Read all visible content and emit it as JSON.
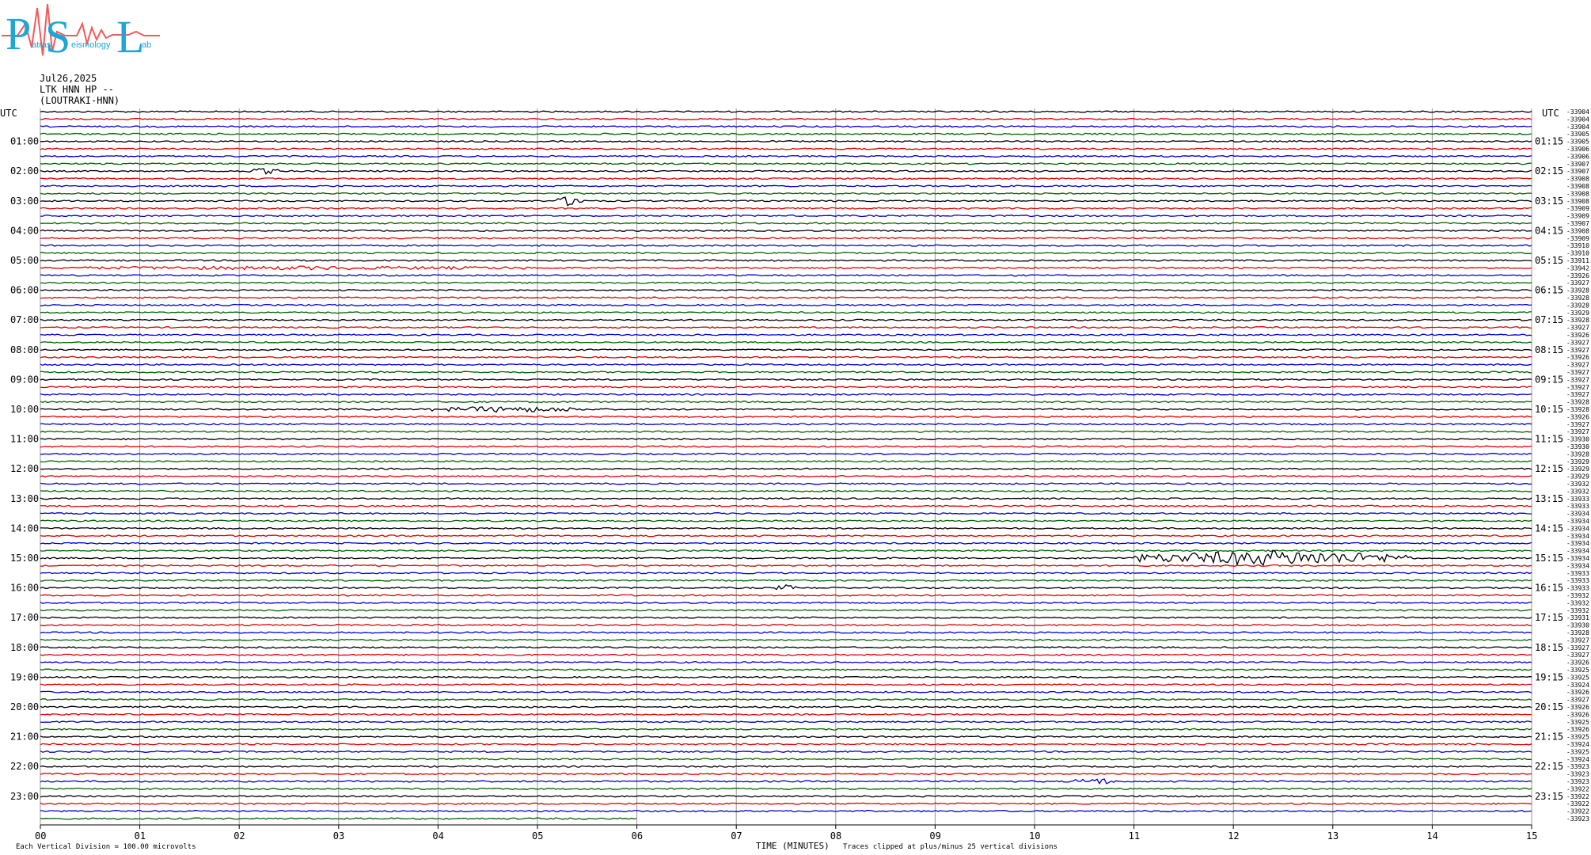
{
  "header": {
    "date": "Jul26,2025",
    "station": "LTK HNN HP --",
    "location": "(LOUTRAKI-HNN)"
  },
  "logo": {
    "letters": [
      "P",
      "S",
      "L"
    ],
    "words": [
      "atras",
      "eismology",
      "ab"
    ],
    "colors": {
      "letters": "#1fa6d6",
      "wave": "#f05a5a"
    }
  },
  "axis": {
    "left_title": "UTC",
    "right_title": "UTC",
    "xlabel": "TIME (MINUTES)",
    "x_ticks": [
      "00",
      "01",
      "02",
      "03",
      "04",
      "05",
      "06",
      "07",
      "08",
      "09",
      "10",
      "11",
      "12",
      "13",
      "14",
      "15"
    ]
  },
  "footer": {
    "division_note": "Each Vertical Division =  100.00 microvolts",
    "clip_note": "Traces clipped at plus/minus 25 vertical divisions"
  },
  "chart_data": {
    "type": "line",
    "description_kind": "helicorder",
    "rows": 96,
    "minutes_per_row": 15,
    "colors": [
      "#000000",
      "#e00000",
      "#0000d0",
      "#006400"
    ],
    "last_row_fraction": 0.4,
    "left_labels": [
      "01:00",
      "02:00",
      "03:00",
      "04:00",
      "05:00",
      "06:00",
      "07:00",
      "08:00",
      "09:00",
      "10:00",
      "11:00",
      "12:00",
      "13:00",
      "14:00",
      "15:00",
      "16:00",
      "17:00",
      "18:00",
      "19:00",
      "20:00",
      "21:00",
      "22:00",
      "23:00"
    ],
    "right_labels": [
      "01:15",
      "02:15",
      "03:15",
      "04:15",
      "05:15",
      "06:15",
      "07:15",
      "08:15",
      "09:15",
      "10:15",
      "11:15",
      "12:15",
      "13:15",
      "14:15",
      "15:15",
      "16:15",
      "17:15",
      "18:15",
      "19:15",
      "20:15",
      "21:15",
      "22:15",
      "23:15"
    ],
    "offsets": [
      "-33904",
      "-33904",
      "-33904",
      "-33905",
      "-33905",
      "-33906",
      "-33906",
      "-33907",
      "-33907",
      "-33908",
      "-33908",
      "-33908",
      "-33908",
      "-33909",
      "-33909",
      "-33907",
      "-33908",
      "-33909",
      "-33910",
      "-33910",
      "-33911",
      "-33942",
      "-33926",
      "-33927",
      "-33928",
      "-33928",
      "-33928",
      "-33929",
      "-33928",
      "-33927",
      "-33926",
      "-33927",
      "-33927",
      "-33926",
      "-33927",
      "-33927",
      "-33927",
      "-33927",
      "-33927",
      "-33928",
      "-33928",
      "-33926",
      "-33927",
      "-33927",
      "-33930",
      "-33930",
      "-33928",
      "-33929",
      "-33929",
      "-33929",
      "-33932",
      "-33932",
      "-33933",
      "-33933",
      "-33934",
      "-33934",
      "-33934",
      "-33934",
      "-33934",
      "-33934",
      "-33934",
      "-33934",
      "-33933",
      "-33933",
      "-33933",
      "-33932",
      "-33932",
      "-33932",
      "-33931",
      "-33930",
      "-33928",
      "-33927",
      "-33927",
      "-33927",
      "-33926",
      "-33925",
      "-33925",
      "-33924",
      "-33926",
      "-33927",
      "-33926",
      "-33926",
      "-33925",
      "-33926",
      "-33925",
      "-33924",
      "-33925",
      "-33924",
      "-33923",
      "-33923",
      "-33923",
      "-33922",
      "-33922",
      "-33922",
      "-33922",
      "-33923"
    ],
    "events": [
      {
        "row": 60,
        "start_min": 11.0,
        "end_min": 13.8,
        "amp": 9
      },
      {
        "row": 21,
        "start_min": 0.3,
        "end_min": 4.9,
        "amp": 1.5
      },
      {
        "row": 12,
        "start_min": 5.2,
        "end_min": 5.5,
        "amp": 6
      },
      {
        "row": 40,
        "start_min": 3.9,
        "end_min": 5.5,
        "amp": 3
      },
      {
        "row": 90,
        "start_min": 10.4,
        "end_min": 10.8,
        "amp": 4
      },
      {
        "row": 8,
        "start_min": 2.1,
        "end_min": 2.4,
        "amp": 3
      },
      {
        "row": 64,
        "start_min": 7.4,
        "end_min": 7.6,
        "amp": 3
      }
    ]
  }
}
